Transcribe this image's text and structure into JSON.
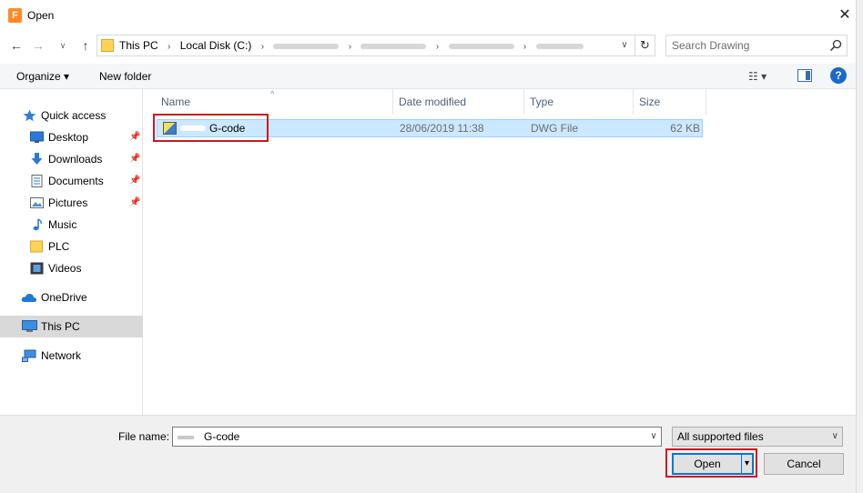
{
  "window": {
    "title": "Open",
    "app_icon_letter": "F",
    "close_glyph": "✕"
  },
  "navigation": {
    "back": "←",
    "forward": "→",
    "recent": "∨",
    "up": "↑",
    "refresh": "↻"
  },
  "address": {
    "crumbs": [
      "This PC",
      "Local Disk (C:)"
    ],
    "separator": "›",
    "dropdown": "∨"
  },
  "search": {
    "placeholder": "Search Drawing"
  },
  "toolbar": {
    "organize_label": "Organize ▾",
    "new_folder_label": "New folder",
    "view_label": "☷ ▾",
    "help_label": "?"
  },
  "sidebar": {
    "items": [
      {
        "label": "Quick access",
        "icon": "star-icon",
        "pinned": false
      },
      {
        "label": "Desktop",
        "icon": "desktop-icon",
        "pinned": true
      },
      {
        "label": "Downloads",
        "icon": "downloads-icon",
        "pinned": true
      },
      {
        "label": "Documents",
        "icon": "documents-icon",
        "pinned": true
      },
      {
        "label": "Pictures",
        "icon": "pictures-icon",
        "pinned": true
      },
      {
        "label": "Music",
        "icon": "music-icon",
        "pinned": false
      },
      {
        "label": "PLC",
        "icon": "folder-icon",
        "pinned": false
      },
      {
        "label": "Videos",
        "icon": "videos-icon",
        "pinned": false
      },
      {
        "label": "OneDrive",
        "icon": "onedrive-icon",
        "pinned": false
      },
      {
        "label": "This PC",
        "icon": "computer-icon",
        "pinned": false,
        "selected": true
      },
      {
        "label": "Network",
        "icon": "network-icon",
        "pinned": false
      }
    ],
    "pin_glyph": "📌"
  },
  "columns": {
    "name": "Name",
    "date": "Date modified",
    "type": "Type",
    "size": "Size",
    "sort_glyph": "^"
  },
  "files": [
    {
      "name": "G-code",
      "date": "28/06/2019 11:38",
      "type": "DWG File",
      "size": "62 KB"
    }
  ],
  "footer": {
    "file_name_label": "File name:",
    "file_name_value": "G-code",
    "filter_value": "All supported files",
    "open_label": "Open",
    "cancel_label": "Cancel",
    "dropdown": "∨",
    "split_glyph": "▾"
  }
}
